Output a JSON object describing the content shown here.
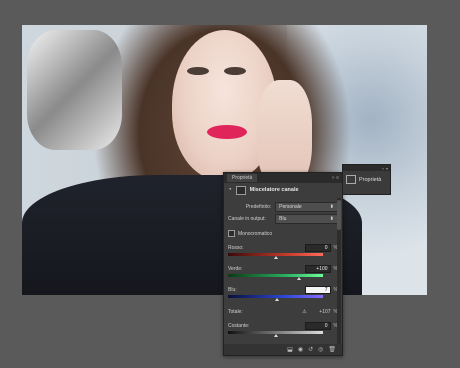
{
  "panel": {
    "tab_label": "Proprietà",
    "collapse_icon": "double-arrow-icon",
    "menu_icon": "panel-menu-icon",
    "title": "Miscelatore canale",
    "preset_label": "Predefinito:",
    "preset_value": "Personale",
    "output_label": "Canale in output:",
    "output_value": "Blu",
    "mono_label": "Monocromatico",
    "red_label": "Rosso:",
    "red_value": "0",
    "green_label": "Verde:",
    "green_value": "+100",
    "blue_label": "Blu:",
    "blue_value": "7",
    "total_label": "Totale:",
    "total_value": "+107",
    "constant_label": "Costante:",
    "constant_value": "0",
    "percent": "%",
    "colors": {
      "red": "#c0392b",
      "green": "#27ae60",
      "blue": "#2c48d8",
      "panel": "#3d3d3d"
    },
    "sliders": {
      "red": 0.5,
      "green": 0.75,
      "blue": 0.52,
      "constant": 0.5
    }
  },
  "mini_panel": {
    "label": "Proprietà"
  }
}
